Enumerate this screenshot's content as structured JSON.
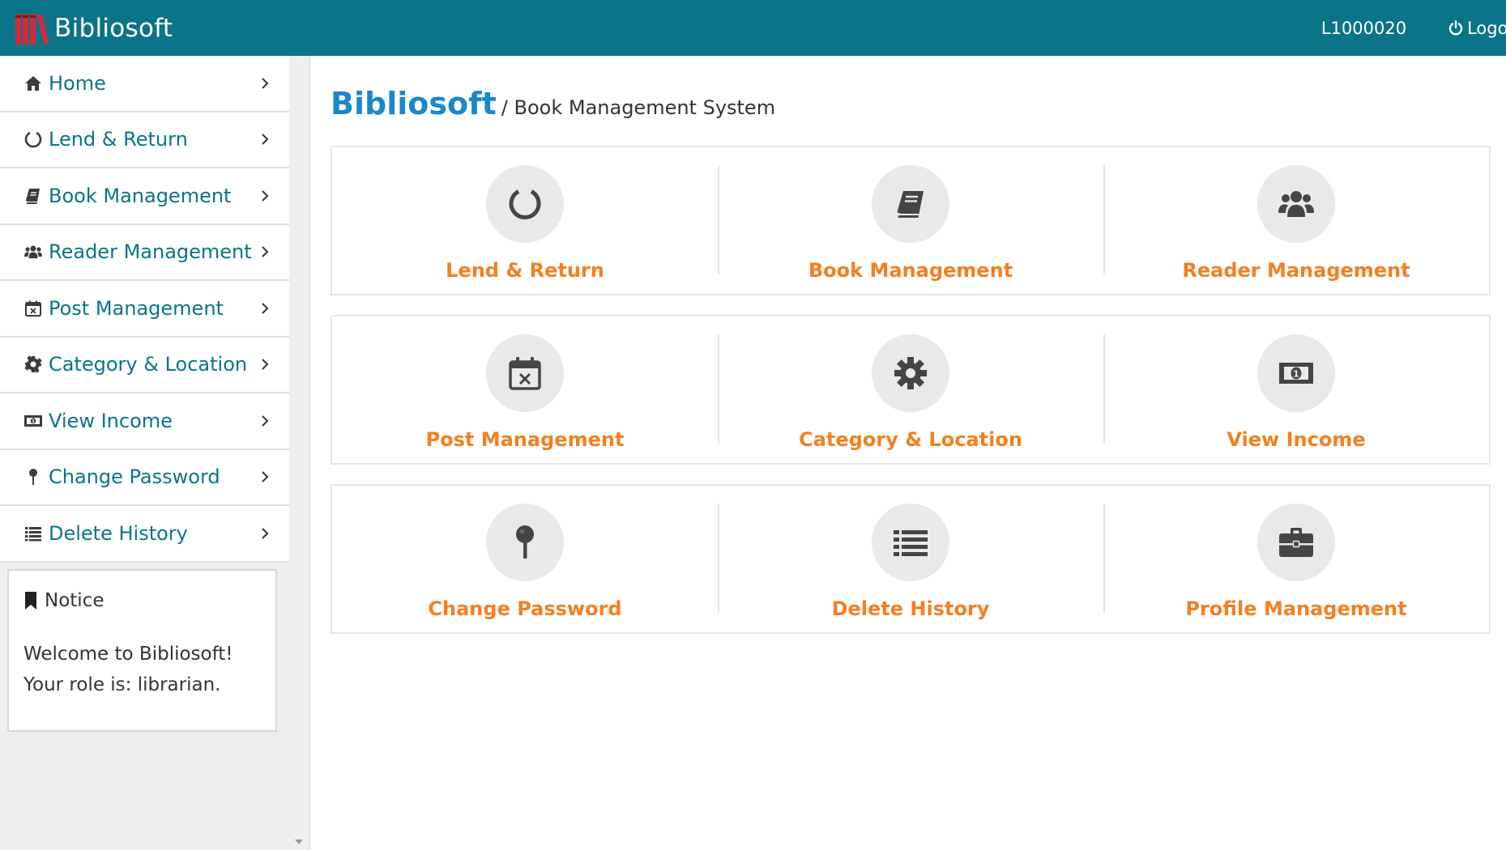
{
  "app": {
    "brand_name": "Bibliosoft",
    "user_id": "L1000020",
    "logout_label": "Logout"
  },
  "sidebar": {
    "items": [
      {
        "label": "Home",
        "icon": "home-icon"
      },
      {
        "label": "Lend & Return",
        "icon": "circle-notch-icon"
      },
      {
        "label": "Book Management",
        "icon": "book-icon"
      },
      {
        "label": "Reader Management",
        "icon": "users-icon"
      },
      {
        "label": "Post Management",
        "icon": "calendar-x-icon"
      },
      {
        "label": "Category & Location",
        "icon": "gear-icon"
      },
      {
        "label": "View Income",
        "icon": "money-bill-icon"
      },
      {
        "label": "Change Password",
        "icon": "map-pin-icon"
      },
      {
        "label": "Delete History",
        "icon": "list-icon"
      }
    ],
    "notice": {
      "title": "Notice",
      "line1": "Welcome to Bibliosoft!",
      "line2": "Your role is: librarian."
    }
  },
  "main": {
    "title": "Bibliosoft",
    "subtitle": "/ Book Management System",
    "tiles": [
      {
        "label": "Lend & Return",
        "icon": "circle-notch-icon"
      },
      {
        "label": "Book Management",
        "icon": "book-icon"
      },
      {
        "label": "Reader Management",
        "icon": "users-icon"
      },
      {
        "label": "Post Management",
        "icon": "calendar-x-icon"
      },
      {
        "label": "Category & Location",
        "icon": "gear-icon"
      },
      {
        "label": "View Income",
        "icon": "money-bill-icon"
      },
      {
        "label": "Change Password",
        "icon": "map-pin-icon"
      },
      {
        "label": "Delete History",
        "icon": "list-icon"
      },
      {
        "label": "Profile Management",
        "icon": "briefcase-icon"
      }
    ]
  },
  "colors": {
    "navbar": "#0a7489",
    "sidebar_text": "#0a7489",
    "title_blue": "#1b88c9",
    "tile_label_orange": "#f47f20",
    "icon_dark": "#454545"
  }
}
